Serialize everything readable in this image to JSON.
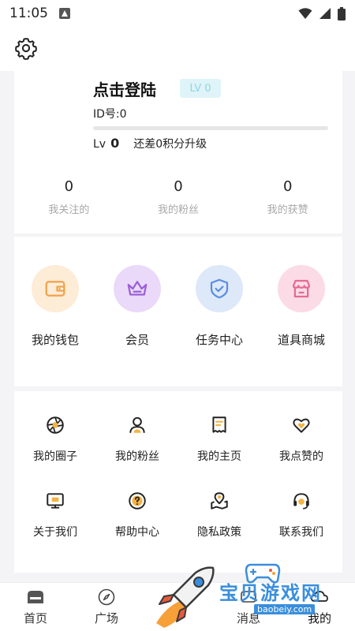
{
  "status_bar": {
    "time": "11:05"
  },
  "profile": {
    "title": "点击登陆",
    "level_badge": "LV 0",
    "id_text": "ID号:0",
    "level_prefix": "Lv",
    "level_value": "0",
    "level_hint": "还差0积分升级",
    "progress": 0
  },
  "stats": [
    {
      "value": "0",
      "label": "我关注的"
    },
    {
      "value": "0",
      "label": "我的粉丝"
    },
    {
      "value": "0",
      "label": "我的获赞"
    }
  ],
  "features": [
    {
      "label": "我的钱包",
      "icon": "wallet-icon",
      "bg": "#fdecd6",
      "color": "#f0a24b"
    },
    {
      "label": "会员",
      "icon": "crown-icon",
      "bg": "#ead9f8",
      "color": "#9b5fd6"
    },
    {
      "label": "任务中心",
      "icon": "shield-check-icon",
      "bg": "#dde8f9",
      "color": "#5a8ee0"
    },
    {
      "label": "道具商城",
      "icon": "store-icon",
      "bg": "#fbdbe6",
      "color": "#e56a94"
    }
  ],
  "menu": [
    {
      "label": "我的圈子",
      "icon": "aperture-icon"
    },
    {
      "label": "我的粉丝",
      "icon": "user-icon"
    },
    {
      "label": "我的主页",
      "icon": "receipt-icon"
    },
    {
      "label": "我点赞的",
      "icon": "heart-icon"
    },
    {
      "label": "关于我们",
      "icon": "monitor-icon"
    },
    {
      "label": "帮助中心",
      "icon": "question-icon"
    },
    {
      "label": "隐私政策",
      "icon": "map-pin-icon"
    },
    {
      "label": "联系我们",
      "icon": "contact-icon"
    }
  ],
  "nav": [
    {
      "label": "首页",
      "icon": "home-icon"
    },
    {
      "label": "广场",
      "icon": "compass-icon"
    },
    {
      "label": "",
      "icon": "center-icon"
    },
    {
      "label": "消息",
      "icon": "message-icon"
    },
    {
      "label": "我的",
      "icon": "profile-icon"
    }
  ],
  "watermark": {
    "text": "宝贝游戏网",
    "url": "baobeiy.com"
  },
  "colors": {
    "accent": "#f5b342",
    "text": "#222222",
    "muted": "#a8a8a8"
  }
}
